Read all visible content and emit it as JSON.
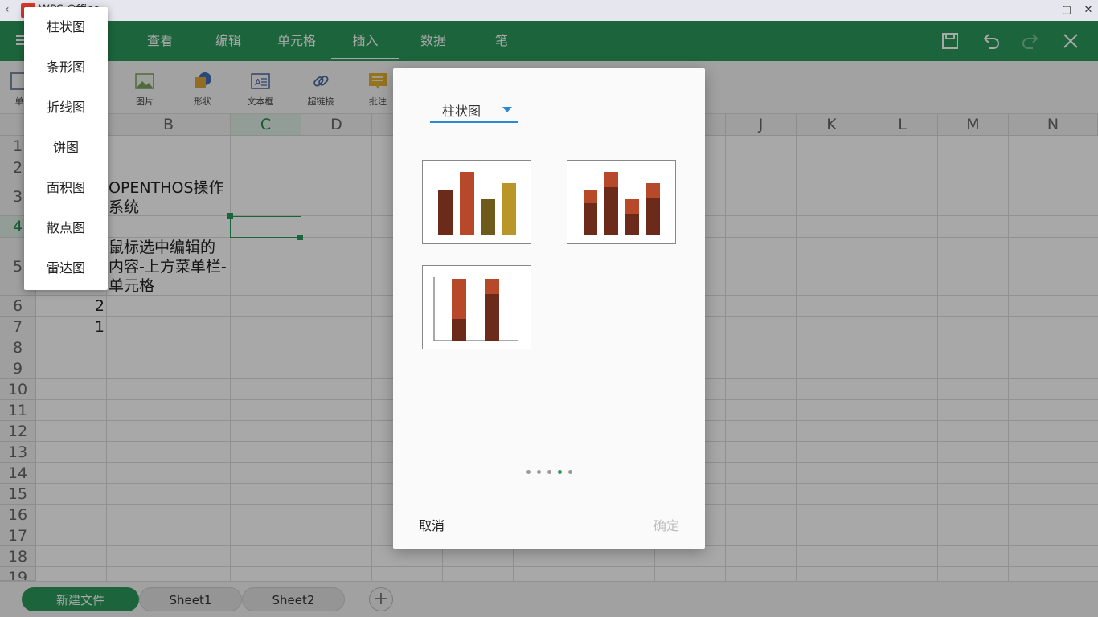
{
  "app": {
    "title": "WPS Office",
    "back_glyph": "‹"
  },
  "window_controls": {
    "minimize": "—",
    "maximize": "▢",
    "close": "✕"
  },
  "ribbon": {
    "tabs": [
      "查看",
      "编辑",
      "单元格",
      "插入",
      "数据",
      "笔"
    ],
    "active_tab": "插入",
    "accent_color": "#2b9a5c"
  },
  "toolbar": {
    "items": [
      {
        "label": "单",
        "icon": "cell-icon"
      },
      {
        "label": "图片",
        "icon": "image-icon"
      },
      {
        "label": "形状",
        "icon": "shape-icon"
      },
      {
        "label": "文本框",
        "icon": "textbox-icon"
      },
      {
        "label": "超链接",
        "icon": "link-icon"
      },
      {
        "label": "批注",
        "icon": "comment-icon"
      }
    ]
  },
  "sheet": {
    "columns": [
      "B",
      "C",
      "D",
      "J",
      "K",
      "L",
      "M",
      "N"
    ],
    "selected_column": "C",
    "rows": [
      "1",
      "2",
      "3",
      "4",
      "5",
      "6",
      "7",
      "8",
      "9",
      "10",
      "11",
      "12",
      "13",
      "14",
      "15",
      "16",
      "17",
      "18",
      "19"
    ],
    "selected_row": "4",
    "cells": {
      "b3_line1": "OPENTHOS操作",
      "b3_line2": "系统",
      "b5_line1": "鼠标选中编辑的",
      "b5_line2": "内容-上方菜单栏-",
      "b5_line3": "单元格",
      "a6": "2",
      "a7": "1"
    }
  },
  "sheet_tabs": [
    "新建文件",
    "Sheet1",
    "Sheet2"
  ],
  "active_sheet": "新建文件",
  "add_sheet": "+",
  "chart_type_menu": {
    "items": [
      "柱状图",
      "条形图",
      "折线图",
      "饼图",
      "面积图",
      "散点图",
      "雷达图"
    ]
  },
  "dialog": {
    "selected_type": "柱状图",
    "page_count": 5,
    "active_page": 4,
    "cancel": "取消",
    "confirm": "确定",
    "thumb_colors": {
      "dark": "#6b2a1a",
      "orange": "#b8482a",
      "olive": "#6e5a1a",
      "gold": "#b8962a"
    }
  }
}
